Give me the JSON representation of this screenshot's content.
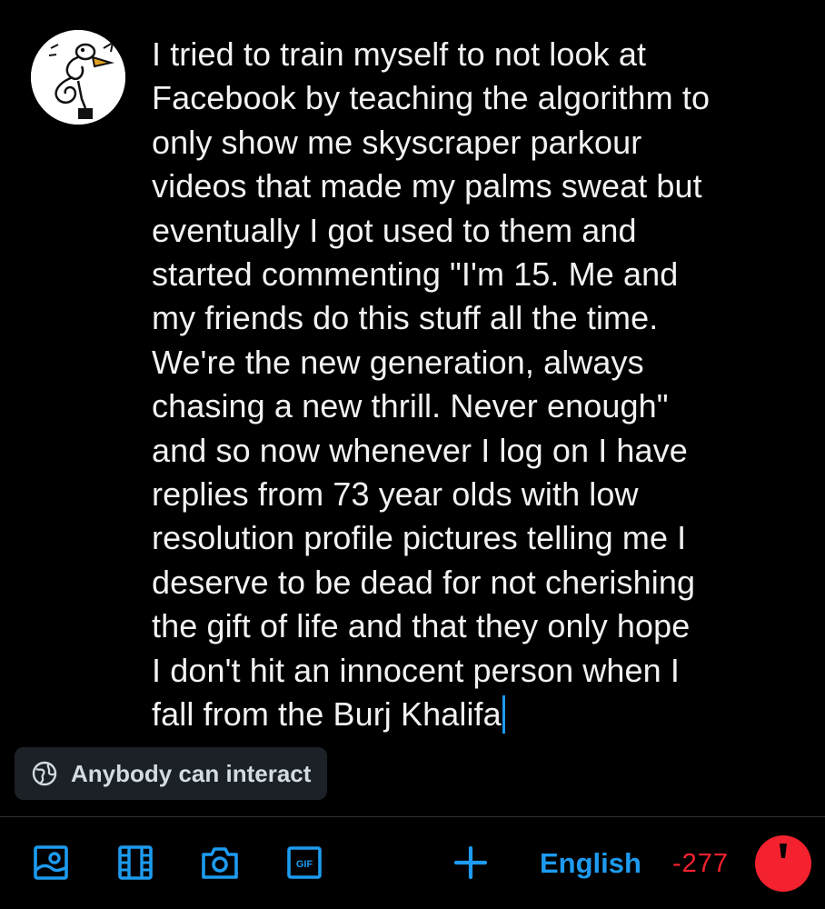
{
  "post": {
    "avatar_icon": "user-avatar-doodle",
    "text_lines": [
      "I tried to train myself to not look at",
      "Facebook by teaching the algorithm to",
      "only show me skyscraper parkour",
      "videos that made my palms sweat but",
      "eventually I got used to them and",
      "started commenting \"I'm 15. Me and",
      "my friends do this stuff all the time.",
      "We're the new generation, always",
      "chasing a new thrill. Never enough\"",
      "and so now whenever I log on I have",
      "replies from 73 year olds with low",
      "resolution profile pictures telling me I",
      "deserve to be dead for not cherishing",
      "the gift of life and that they only hope",
      "I don't hit an innocent person when I",
      "fall from the Burj Khalifa"
    ]
  },
  "reply_setting": {
    "icon": "globe-icon",
    "label": "Anybody can interact"
  },
  "toolbar": {
    "icons": [
      "image-icon",
      "film-icon",
      "camera-icon",
      "gif-icon"
    ],
    "add_icon": "plus-icon",
    "language": "English",
    "char_count": "-277",
    "char_ring_state": "over-limit"
  },
  "colors": {
    "background": "#000000",
    "accent": "#1d9bf0",
    "error": "#f4212e",
    "chip_bg": "#1c2127",
    "text": "#f2f2f2"
  }
}
